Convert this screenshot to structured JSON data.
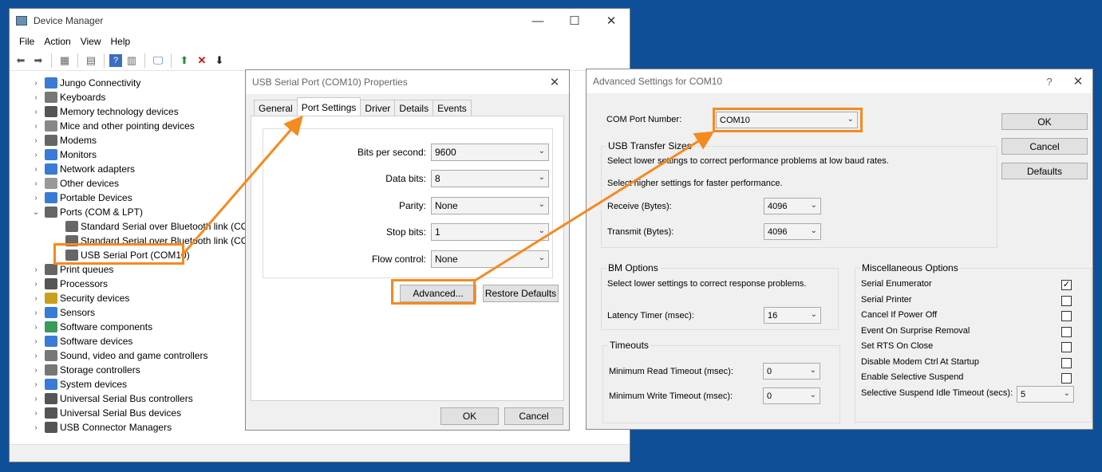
{
  "device_manager": {
    "title": "Device Manager",
    "window_controls": [
      "—",
      "☐",
      "✕"
    ],
    "menu": [
      "File",
      "Action",
      "View",
      "Help"
    ],
    "tree": [
      {
        "label": "Jungo Connectivity",
        "expander": "›",
        "indent": 0,
        "icon_color": "#3a7bd5"
      },
      {
        "label": "Keyboards",
        "expander": "›",
        "indent": 0,
        "icon_color": "#777"
      },
      {
        "label": "Memory technology devices",
        "expander": "›",
        "indent": 0,
        "icon_color": "#555"
      },
      {
        "label": "Mice and other pointing devices",
        "expander": "›",
        "indent": 0,
        "icon_color": "#888"
      },
      {
        "label": "Modems",
        "expander": "›",
        "indent": 0,
        "icon_color": "#666"
      },
      {
        "label": "Monitors",
        "expander": "›",
        "indent": 0,
        "icon_color": "#3a7bd5"
      },
      {
        "label": "Network adapters",
        "expander": "›",
        "indent": 0,
        "icon_color": "#3a7bd5"
      },
      {
        "label": "Other devices",
        "expander": "›",
        "indent": 0,
        "icon_color": "#999"
      },
      {
        "label": "Portable Devices",
        "expander": "›",
        "indent": 0,
        "icon_color": "#3a7bd5"
      },
      {
        "label": "Ports (COM & LPT)",
        "expander": "⌄",
        "indent": 0,
        "icon_color": "#666"
      },
      {
        "label": "Standard Serial over Bluetooth link (COM",
        "expander": "",
        "indent": 1,
        "icon_color": "#666"
      },
      {
        "label": "Standard Serial over Bluetooth link (COM",
        "expander": "",
        "indent": 1,
        "icon_color": "#666"
      },
      {
        "label": "USB Serial Port (COM10)",
        "expander": "",
        "indent": 1,
        "icon_color": "#666"
      },
      {
        "label": "Print queues",
        "expander": "›",
        "indent": 0,
        "icon_color": "#666"
      },
      {
        "label": "Processors",
        "expander": "›",
        "indent": 0,
        "icon_color": "#555"
      },
      {
        "label": "Security devices",
        "expander": "›",
        "indent": 0,
        "icon_color": "#c8a020"
      },
      {
        "label": "Sensors",
        "expander": "›",
        "indent": 0,
        "icon_color": "#3a7bd5"
      },
      {
        "label": "Software components",
        "expander": "›",
        "indent": 0,
        "icon_color": "#3a9a5a"
      },
      {
        "label": "Software devices",
        "expander": "›",
        "indent": 0,
        "icon_color": "#3a7bd5"
      },
      {
        "label": "Sound, video and game controllers",
        "expander": "›",
        "indent": 0,
        "icon_color": "#777"
      },
      {
        "label": "Storage controllers",
        "expander": "›",
        "indent": 0,
        "icon_color": "#777"
      },
      {
        "label": "System devices",
        "expander": "›",
        "indent": 0,
        "icon_color": "#3a7bd5"
      },
      {
        "label": "Universal Serial Bus controllers",
        "expander": "›",
        "indent": 0,
        "icon_color": "#555"
      },
      {
        "label": "Universal Serial Bus devices",
        "expander": "›",
        "indent": 0,
        "icon_color": "#555"
      },
      {
        "label": "USB Connector Managers",
        "expander": "›",
        "indent": 0,
        "icon_color": "#555"
      }
    ]
  },
  "properties": {
    "title": "USB Serial Port (COM10) Properties",
    "close": "✕",
    "tabs": [
      "General",
      "Port Settings",
      "Driver",
      "Details",
      "Events"
    ],
    "fields": [
      {
        "label": "Bits per second:",
        "value": "9600"
      },
      {
        "label": "Data bits:",
        "value": "8"
      },
      {
        "label": "Parity:",
        "value": "None"
      },
      {
        "label": "Stop bits:",
        "value": "1"
      },
      {
        "label": "Flow control:",
        "value": "None"
      }
    ],
    "advanced_label": "Advanced...",
    "restore_label": "Restore Defaults",
    "ok_label": "OK",
    "cancel_label": "Cancel"
  },
  "advanced": {
    "title": "Advanced Settings for COM10",
    "help": "?",
    "close": "✕",
    "com_port_label": "COM Port Number:",
    "com_port_value": "COM10",
    "ok_label": "OK",
    "cancel_label": "Cancel",
    "defaults_label": "Defaults",
    "usb_group": "USB Transfer Sizes",
    "usb_text1": "Select lower settings to correct performance problems at low baud rates.",
    "usb_text2": "Select higher settings for faster performance.",
    "receive_label": "Receive (Bytes):",
    "receive_value": "4096",
    "transmit_label": "Transmit (Bytes):",
    "transmit_value": "4096",
    "bm_group": "BM Options",
    "bm_text": "Select lower settings to correct response problems.",
    "latency_label": "Latency Timer (msec):",
    "latency_value": "16",
    "timeouts_group": "Timeouts",
    "read_timeout_label": "Minimum Read Timeout (msec):",
    "read_timeout_value": "0",
    "write_timeout_label": "Minimum Write Timeout (msec):",
    "write_timeout_value": "0",
    "misc_group": "Miscellaneous Options",
    "misc": [
      {
        "label": "Serial Enumerator",
        "checked": true
      },
      {
        "label": "Serial Printer",
        "checked": false
      },
      {
        "label": "Cancel If Power Off",
        "checked": false
      },
      {
        "label": "Event On Surprise Removal",
        "checked": false
      },
      {
        "label": "Set RTS On Close",
        "checked": false
      },
      {
        "label": "Disable Modem Ctrl At Startup",
        "checked": false
      },
      {
        "label": "Enable Selective Suspend",
        "checked": false
      }
    ],
    "suspend_label": "Selective Suspend Idle Timeout (secs):",
    "suspend_value": "5"
  },
  "colors": {
    "highlight": "#f58a1f",
    "desktop": "#0f4f98"
  }
}
